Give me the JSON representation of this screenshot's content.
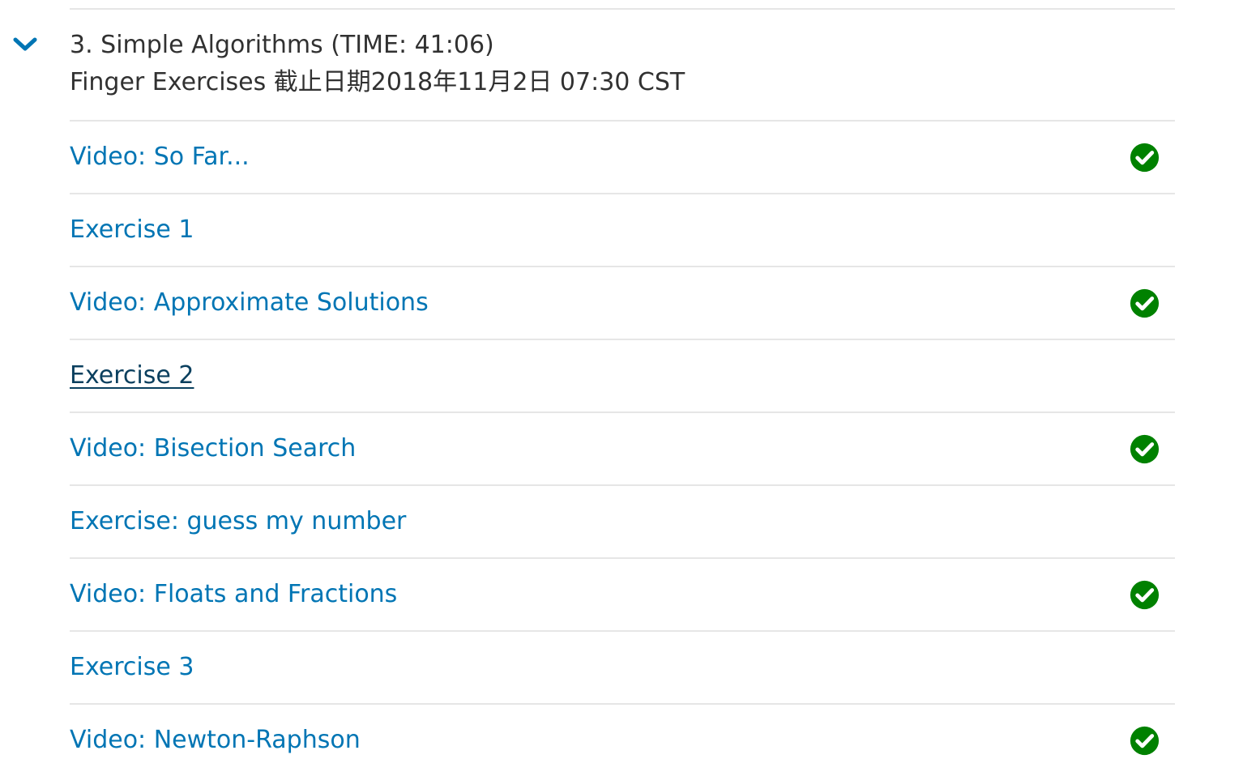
{
  "section": {
    "title": "3. Simple Algorithms (TIME: 41:06)",
    "subtitle": "Finger Exercises 截止日期2018年11月2日 07:30 CST",
    "toggle_icon": "chevron-down-icon"
  },
  "colors": {
    "link": "#0075b4",
    "link_hover": "#0a3f5e",
    "text": "#313131",
    "complete": "#008100",
    "divider": "#e6e6e6"
  },
  "items": [
    {
      "label": "Video: So Far...",
      "completed": true
    },
    {
      "label": "Exercise 1",
      "completed": false
    },
    {
      "label": "Video: Approximate Solutions",
      "completed": true
    },
    {
      "label": "Exercise 2",
      "completed": false,
      "hovered": true
    },
    {
      "label": "Video: Bisection Search",
      "completed": true
    },
    {
      "label": "Exercise: guess my number",
      "completed": false
    },
    {
      "label": "Video: Floats and Fractions",
      "completed": true
    },
    {
      "label": "Exercise 3",
      "completed": false
    },
    {
      "label": "Video: Newton-Raphson",
      "completed": true
    }
  ]
}
